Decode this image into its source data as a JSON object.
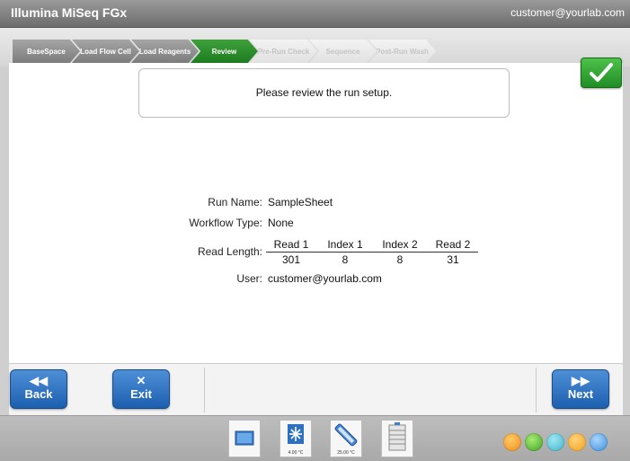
{
  "app": {
    "title": "Illumina MiSeq FGx",
    "user": "customer@yourlab.com"
  },
  "workflow": {
    "steps": [
      {
        "label": "BaseSpace",
        "state": "done"
      },
      {
        "label": "Load Flow Cell",
        "state": "done"
      },
      {
        "label": "Load Reagents",
        "state": "done"
      },
      {
        "label": "Review",
        "state": "active"
      },
      {
        "label": "Pre-Run Check",
        "state": "pending"
      },
      {
        "label": "Sequence",
        "state": "pending"
      },
      {
        "label": "Post-Run Wash",
        "state": "pending"
      }
    ]
  },
  "review": {
    "message": "Please review the run setup.",
    "run_name_label": "Run Name:",
    "run_name": "SampleSheet",
    "workflow_type_label": "Workflow Type:",
    "workflow_type": "None",
    "read_length_label": "Read Length:",
    "reads": [
      {
        "name": "Read 1",
        "value": "301"
      },
      {
        "name": "Index 1",
        "value": "8"
      },
      {
        "name": "Index 2",
        "value": "8"
      },
      {
        "name": "Read 2",
        "value": "31"
      }
    ],
    "user_label": "User:",
    "user": "customer@yourlab.com"
  },
  "buttons": {
    "back": {
      "glyph": "◀◀",
      "label": "Back"
    },
    "exit": {
      "glyph": "✕",
      "label": "Exit"
    },
    "next": {
      "glyph": "▶▶",
      "label": "Next"
    }
  },
  "status": {
    "chiller_temp": "4.00 °C",
    "flowcell_temp": "25.00 °C"
  },
  "colors": {
    "active_step": "#2a8b2c",
    "accent_blue": "#2a6fc0",
    "orange": "#f08a1c",
    "green": "#5bbf3a",
    "teal": "#3fb3c8",
    "blue": "#3a8fd8"
  }
}
